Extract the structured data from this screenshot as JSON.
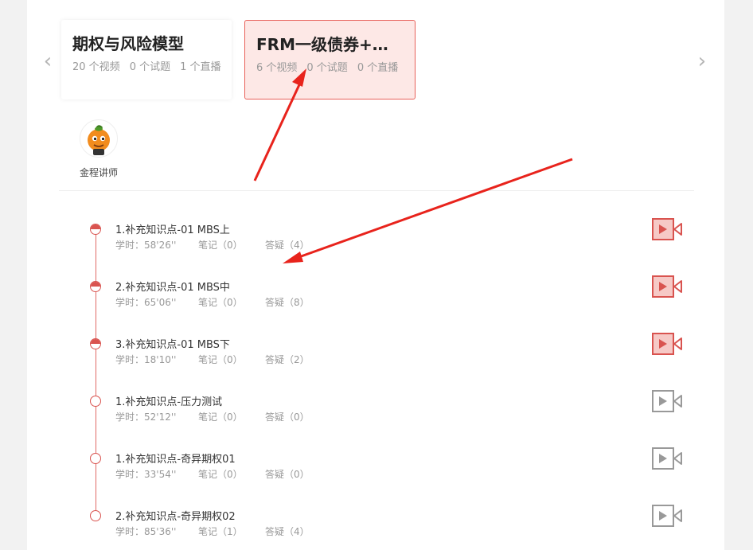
{
  "courses": [
    {
      "title": "期权与风险模型",
      "stats": [
        "20 个视频",
        "0 个试题",
        "1 个直播"
      ],
      "active": false
    },
    {
      "title": "FRM一级债券+期...",
      "stats": [
        "6 个视频",
        "0 个试题",
        "0 个直播"
      ],
      "active": true
    }
  ],
  "teacher": {
    "name": "金程讲师"
  },
  "lessons": [
    {
      "title": "1.补充知识点-01 MBS上",
      "time": "学时：58'26''",
      "notes": "笔记（0）",
      "qa": "答疑（4）",
      "progress": "partial"
    },
    {
      "title": "2.补充知识点-01 MBS中",
      "time": "学时：65'06''",
      "notes": "笔记（0）",
      "qa": "答疑（8）",
      "progress": "partial"
    },
    {
      "title": "3.补充知识点-01 MBS下",
      "time": "学时：18'10''",
      "notes": "笔记（0）",
      "qa": "答疑（2）",
      "progress": "partial"
    },
    {
      "title": "1.补充知识点-压力测试",
      "time": "学时：52'12''",
      "notes": "笔记（0）",
      "qa": "答疑（0）",
      "progress": "none"
    },
    {
      "title": "1.补充知识点-奇异期权01",
      "time": "学时：33'54''",
      "notes": "笔记（0）",
      "qa": "答疑（0）",
      "progress": "none"
    },
    {
      "title": "2.补充知识点-奇异期权02",
      "time": "学时：85'36''",
      "notes": "笔记（1）",
      "qa": "答疑（4）",
      "progress": "none"
    }
  ],
  "colors": {
    "accent": "#d9534f",
    "active_card_bg": "#fde8e6",
    "inactive_icon": "#999999",
    "annotation_arrow": "#e8231c"
  }
}
